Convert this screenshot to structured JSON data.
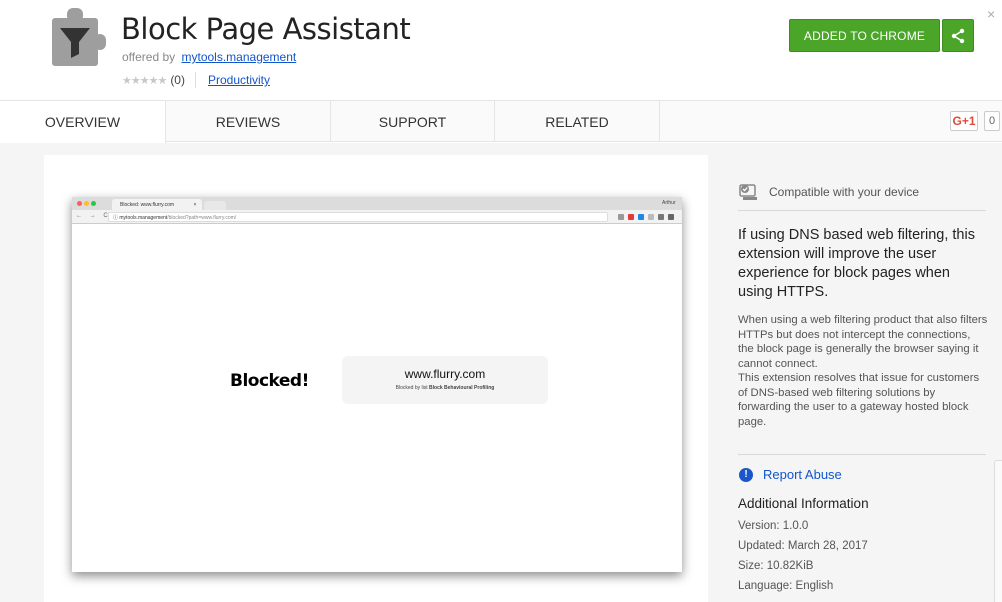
{
  "header": {
    "title": "Block Page Assistant",
    "offered_prefix": "offered by",
    "developer": "mytools.management",
    "rating_stars": "★★★★★",
    "rating_count": "(0)",
    "category": "Productivity",
    "added_button": "ADDED TO CHROME",
    "close": "×",
    "colors": {
      "accent_green": "#4aa528",
      "link_blue": "#1155cc"
    }
  },
  "tabs": [
    {
      "label": "OVERVIEW",
      "active": true
    },
    {
      "label": "REVIEWS",
      "active": false
    },
    {
      "label": "SUPPORT",
      "active": false
    },
    {
      "label": "RELATED",
      "active": false
    }
  ],
  "gplus": {
    "label": "G+1",
    "count": "0"
  },
  "screenshot": {
    "tab_title": "Blocked: www.flurry.com",
    "tab_close": "×",
    "user": "Arthur",
    "nav": "← → C",
    "url_host": "ⓘ mytools.management",
    "url_path": "/blocked?path=www.flurry.com/",
    "blocked_label": "Blocked!",
    "blocked_domain": "www.flurry.com",
    "blocked_by_prefix": "Blocked by list",
    "blocked_by_list": "Block Behavioural Profiling"
  },
  "sidebar": {
    "compatible": "Compatible with your device",
    "heading": "If using DNS based web filtering, this extension will improve the user experience for block pages when using HTTPS.",
    "body_1": "When using a web filtering product that also filters HTTPs but does not intercept the connections, the block page is generally the browser saying it cannot connect.",
    "body_2": "This extension resolves that issue for customers of DNS-based web filtering solutions by forwarding the user to a gateway hosted block page.",
    "report_icon": "!",
    "report_abuse": "Report Abuse",
    "additional_title": "Additional Information",
    "version": "Version: 1.0.0",
    "updated": "Updated: March 28, 2017",
    "size": "Size: 10.82KiB",
    "language": "Language: English"
  }
}
